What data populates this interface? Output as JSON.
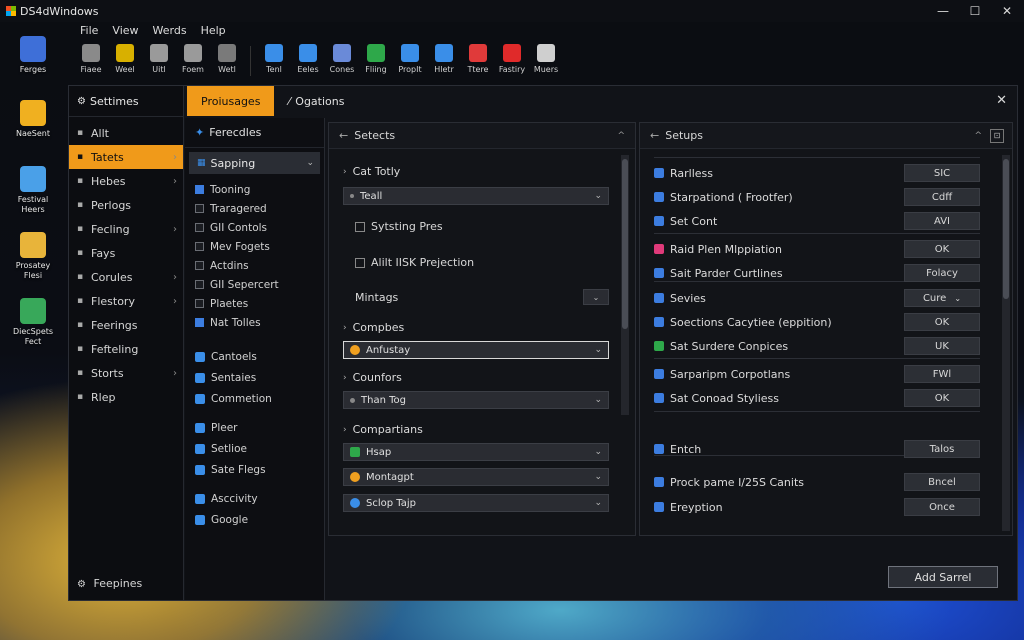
{
  "titlebar": {
    "title": "DS4dWindows",
    "minimize": "—",
    "maximize": "☐",
    "close": "✕"
  },
  "desktop_icons": [
    {
      "label": "Ferges",
      "color": "#3e6fd8"
    },
    {
      "label": "NaeSent",
      "color": "#f0b020"
    },
    {
      "label": "Festival Heers",
      "color": "#4aa0e8"
    },
    {
      "label": "Prosatey Flesi",
      "color": "#e8b43a"
    },
    {
      "label": "DiecSpets Fect",
      "color": "#38a85a"
    }
  ],
  "menu": [
    "File",
    "View",
    "Werds",
    "Help"
  ],
  "toolbar": [
    {
      "label": "Fiaee",
      "color": "#8a8a8a"
    },
    {
      "label": "Weel",
      "color": "#d8b000"
    },
    {
      "label": "Uitl",
      "color": "#9a9a9a"
    },
    {
      "label": "Foem",
      "color": "#9a9a9a"
    },
    {
      "label": "Wetl",
      "color": "#7a7a7a"
    },
    {
      "label": "Tenl",
      "color": "#3a8ee8"
    },
    {
      "label": "Eeles",
      "color": "#3a8ee8"
    },
    {
      "label": "Cones",
      "color": "#6a8ad8"
    },
    {
      "label": "Fliing",
      "color": "#2ea84a"
    },
    {
      "label": "PropIt",
      "color": "#3a8ee8"
    },
    {
      "label": "Hletr",
      "color": "#3a8ee8"
    },
    {
      "label": "Ttere",
      "color": "#e03a3a"
    },
    {
      "label": "Fastiry",
      "color": "#e02a2a"
    },
    {
      "label": "Muers",
      "color": "#cfcfcf"
    }
  ],
  "nav": {
    "header": "Settimes",
    "items": [
      {
        "label": "Allt",
        "chev": false
      },
      {
        "label": "Tatets",
        "chev": true,
        "active": true
      },
      {
        "label": "Hebes",
        "chev": true
      },
      {
        "label": "Perlogs",
        "chev": false
      },
      {
        "label": "Fecling",
        "chev": true
      },
      {
        "label": "Fays",
        "chev": false
      },
      {
        "label": "Corules",
        "chev": true
      },
      {
        "label": "Flestory",
        "chev": true
      },
      {
        "label": "Feerings",
        "chev": false
      },
      {
        "label": "Fefteling",
        "chev": false
      },
      {
        "label": "Storts",
        "chev": true
      },
      {
        "label": "Rlep",
        "chev": false
      }
    ],
    "bottom": "Feepines"
  },
  "tabs": [
    {
      "label": "Proiusages",
      "active": true
    },
    {
      "label": "Ogations",
      "active": false
    }
  ],
  "sub": {
    "header": "Ferecdles",
    "selected": "Sapping",
    "checks": [
      {
        "label": "Tooning",
        "on": true
      },
      {
        "label": "Traragered",
        "on": false
      },
      {
        "label": "GII Contols",
        "on": false
      },
      {
        "label": "Mev Fogets",
        "on": false
      },
      {
        "label": "Actdins",
        "on": false
      },
      {
        "label": "GII Sepercert",
        "on": false
      },
      {
        "label": "Plaetes",
        "on": false
      },
      {
        "label": "Nat Tolles",
        "on": true
      }
    ],
    "links": [
      {
        "label": "Cantoels",
        "color": "#3a8ee8"
      },
      {
        "label": "Sentaies",
        "color": "#3a8ee8"
      },
      {
        "label": "Commetion",
        "color": "#3a8ee8"
      },
      {
        "label": "Pleer",
        "color": "#3a8ee8"
      },
      {
        "label": "Setlioe",
        "color": "#3a8ee8"
      },
      {
        "label": "Sate Flegs",
        "color": "#3a8ee8"
      },
      {
        "label": "Asccivity",
        "color": "#3a8ee8"
      },
      {
        "label": "Google",
        "color": "#3a8ee8"
      }
    ]
  },
  "panel1": {
    "header": "Setects",
    "cat_label": "Cat Totly",
    "cat_value": "Teall",
    "check1": "Sytsting Pres",
    "check2": "Alilt IISK Prejection",
    "mintags": "Mintags",
    "compbes": "Compbes",
    "compbes_value": "Anfustay",
    "counfors": "Counfors",
    "counfors_value": "Than Tog",
    "compartians": "Compartians",
    "drop_a": "Hsap",
    "drop_b": "Montagpt",
    "drop_c": "Sclop Tajp"
  },
  "panel2": {
    "header": "Setups",
    "pin": "⊡",
    "rows": [
      {
        "label": "Rarlless",
        "btn": "SIC",
        "color": "#3c7de0"
      },
      {
        "label": "Starpationd ( Frootfer)",
        "btn": "Cdff",
        "color": "#3c7de0"
      },
      {
        "label": "Set Cont",
        "btn": "AVI",
        "color": "#3c7de0"
      },
      {
        "label": "Raid Plen Mlppiation",
        "btn": "OK",
        "color": "#e03a7a"
      },
      {
        "label": "Sait Parder Curtlines",
        "btn": "Folacy",
        "color": "#3c7de0"
      },
      {
        "label": "Sevies",
        "btn": "Cure",
        "color": "#3c7de0",
        "dd": "⌄"
      },
      {
        "label": "Soections  Cacytiee (eppition)",
        "btn": "OK",
        "color": "#3c7de0"
      },
      {
        "label": "Sat Surdere Conpices",
        "btn": "UK",
        "color": "#2ea84a"
      },
      {
        "label": "Sarparipm Corpotlans",
        "btn": "FWl",
        "color": "#3c7de0"
      },
      {
        "label": "Sat Conoad Styliess",
        "btn": "OK",
        "color": "#3c7de0"
      },
      {
        "label": "Entch",
        "btn": "Talos",
        "color": "#3c7de0"
      },
      {
        "label": "Prock pame I/25S Canits",
        "btn": "Bncel",
        "color": "#3c7de0"
      },
      {
        "label": "Ereyption",
        "btn": "Once",
        "color": "#3c7de0"
      }
    ]
  },
  "add_button": "Add Sarrel"
}
